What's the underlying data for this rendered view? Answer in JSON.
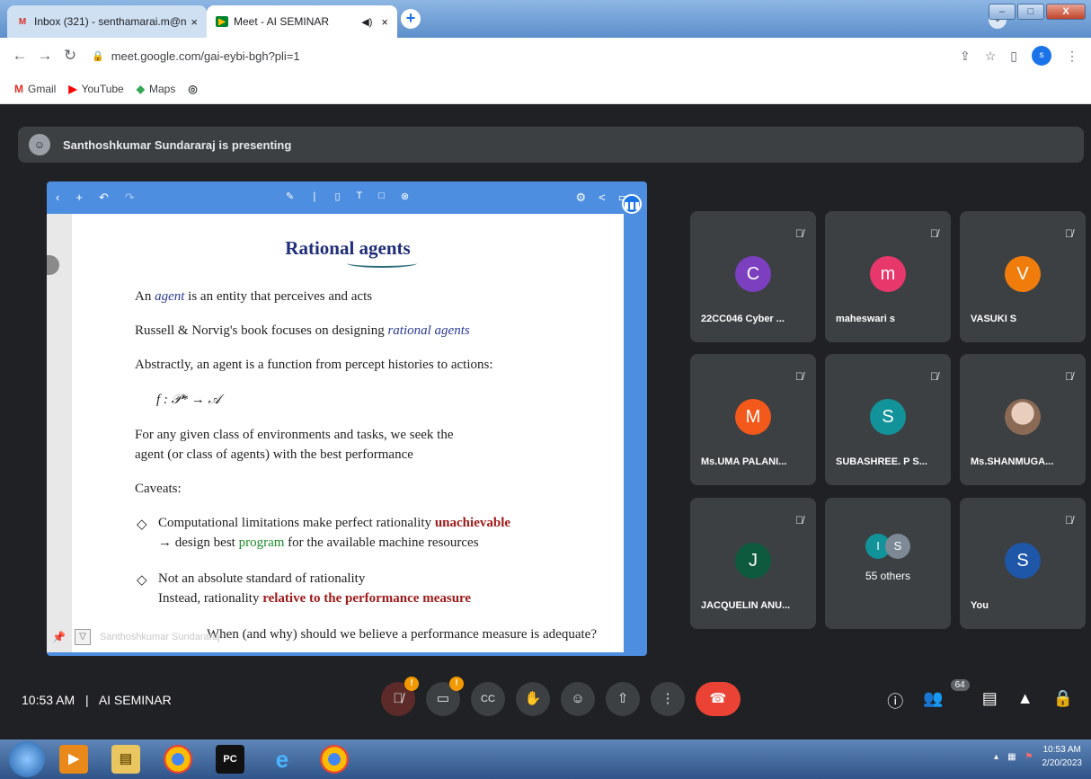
{
  "browser": {
    "tabs": [
      {
        "title": "Inbox (321) - senthamarai.m@n",
        "icon": "gmail-icon",
        "active": false
      },
      {
        "title": "Meet - AI SEMINAR",
        "icon": "meet-icon",
        "active": true
      }
    ],
    "url": "meet.google.com/gai-eybi-bgh?pli=1",
    "profile_initial": "s",
    "bookmarks": [
      "Gmail",
      "YouTube",
      "Maps"
    ]
  },
  "presenting_banner": "Santhoshkumar Sundararaj is presenting",
  "slide": {
    "title": "Rational agents",
    "lines": {
      "l1_pre": "An ",
      "l1_em": "agent",
      "l1_post": " is an entity that perceives and acts",
      "l2_pre": "Russell & Norvig's book focuses on designing ",
      "l2_em": "rational agents",
      "l3": "Abstractly, an agent is a function from percept histories to actions:",
      "formula": "f : 𝒫* → 𝒜",
      "l4a": "For any given class of environments and tasks, we seek the",
      "l4b": "agent (or class of agents) with the best performance",
      "caveats": "Caveats:",
      "c1_pre": "Computational limitations make perfect rationality ",
      "c1_red": "unachievable",
      "c1b_pre": "→ design best ",
      "c1b_green": "program",
      "c1b_post": " for the available machine resources",
      "c2": "Not an absolute standard of rationality",
      "c2b_pre": "Instead, rationality ",
      "c2b_red": "relative to the performance measure",
      "c3": "When (and why) should we believe a performance measure is adequate?"
    },
    "footer_ghost": "Santhoshkumar Sundararaj"
  },
  "participants": [
    {
      "initial": "C",
      "name": "22CC046 Cyber ...",
      "color": "#7b3fbf"
    },
    {
      "initial": "m",
      "name": "maheswari s",
      "color": "#e8376b"
    },
    {
      "initial": "V",
      "name": "VASUKI S",
      "color": "#f07c0c"
    },
    {
      "initial": "M",
      "name": "Ms.UMA PALANI...",
      "color": "#f2591a"
    },
    {
      "initial": "S",
      "name": "SUBASHREE. P S...",
      "color": "#12939a"
    },
    {
      "initial": "",
      "name": "Ms.SHANMUGA...",
      "color": "#c9a896"
    },
    {
      "initial": "J",
      "name": "JACQUELIN ANU...",
      "color": "#0d5a3e"
    },
    {
      "initial": "S",
      "name": "You",
      "color": "#1e56a8"
    }
  ],
  "others": {
    "label": "55 others",
    "initials": [
      "I",
      "S"
    ],
    "colors": [
      "#12939a",
      "#7d8a96"
    ]
  },
  "meeting": {
    "time": "10:53 AM",
    "separator": "|",
    "name": "AI SEMINAR",
    "people_count": "64"
  },
  "controls": {
    "mic_badge": "!",
    "cam_badge": "!"
  },
  "taskbar": {
    "time": "10:53 AM",
    "date": "2/20/2023"
  }
}
